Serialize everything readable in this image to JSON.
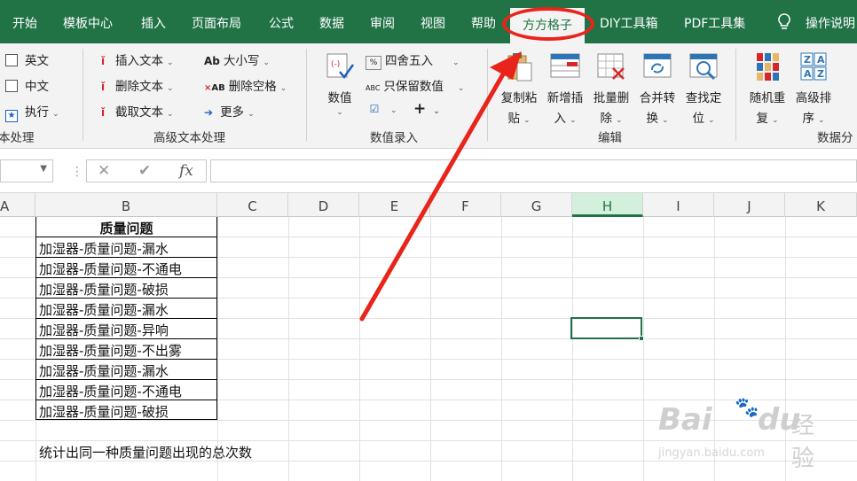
{
  "menu": {
    "tabs": [
      {
        "label": "开始"
      },
      {
        "label": "模板中心"
      },
      {
        "label": "插入"
      },
      {
        "label": "页面布局"
      },
      {
        "label": "公式"
      },
      {
        "label": "数据"
      },
      {
        "label": "审阅"
      },
      {
        "label": "视图"
      },
      {
        "label": "帮助"
      },
      {
        "label": "方方格子"
      },
      {
        "label": "DIY工具箱"
      },
      {
        "label": "PDF工具集"
      }
    ],
    "active_tab": "方方格子",
    "help_label": "操作说明"
  },
  "ribbon": {
    "text_processing": {
      "items": [
        "英文",
        "中文",
        "执行"
      ],
      "group_label": "本处理"
    },
    "advanced_text": {
      "items": [
        "插入文本",
        "删除文本",
        "截取文本",
        "大小写",
        "删除空格",
        "更多"
      ],
      "icon_text": {
        "case": "Ab",
        "space": "AB"
      },
      "group_label": "高级文本处理"
    },
    "value_entry": {
      "numeric_label": "数值",
      "round_label": "四舍五入",
      "keep_value_label": "只保留数值",
      "round_icon_text": "%",
      "keep_icon_text": "ABC",
      "plus": "+",
      "group_label": "数值录入"
    },
    "edit": {
      "buttons": [
        {
          "line1": "复制粘",
          "line2": "贴"
        },
        {
          "line1": "新增插",
          "line2": "入"
        },
        {
          "line1": "批量删",
          "line2": "除"
        },
        {
          "line1": "合并转",
          "line2": "换"
        },
        {
          "line1": "查找定",
          "line2": "位"
        }
      ],
      "group_label": "编辑"
    },
    "data_analysis": {
      "buttons": [
        {
          "line1": "随机重",
          "line2": "复"
        },
        {
          "line1": "高级排",
          "line2": "序"
        }
      ],
      "sort_icon_text": {
        "top": "Z",
        "top2": "A",
        "bottom": "A",
        "bottom2": "Z"
      },
      "group_label": "数据分"
    }
  },
  "formula_bar": {
    "name_box": "",
    "cancel": "✕",
    "enter": "✔",
    "fx": "fx",
    "value": ""
  },
  "columns": [
    "A",
    "B",
    "C",
    "D",
    "E",
    "F",
    "G",
    "H",
    "I",
    "J",
    "K"
  ],
  "selected_column": "H",
  "sheet": {
    "header": "质量问题",
    "rows": [
      "加湿器-质量问题-漏水",
      "加湿器-质量问题-不通电",
      "加湿器-质量问题-破损",
      "加湿器-质量问题-漏水",
      "加湿器-质量问题-异响",
      "加湿器-质量问题-不出雾",
      "加湿器-质量问题-漏水",
      "加湿器-质量问题-不通电",
      "加湿器-质量问题-破损"
    ],
    "note": "统计出同一种质量问题出现的总次数"
  },
  "watermark": {
    "brand": "Bai",
    "brand2": "du",
    "chinese": "经验",
    "url": "jingyan.baidu.com"
  },
  "colors": {
    "excel_green": "#217346",
    "highlight_red": "#e8241b"
  }
}
